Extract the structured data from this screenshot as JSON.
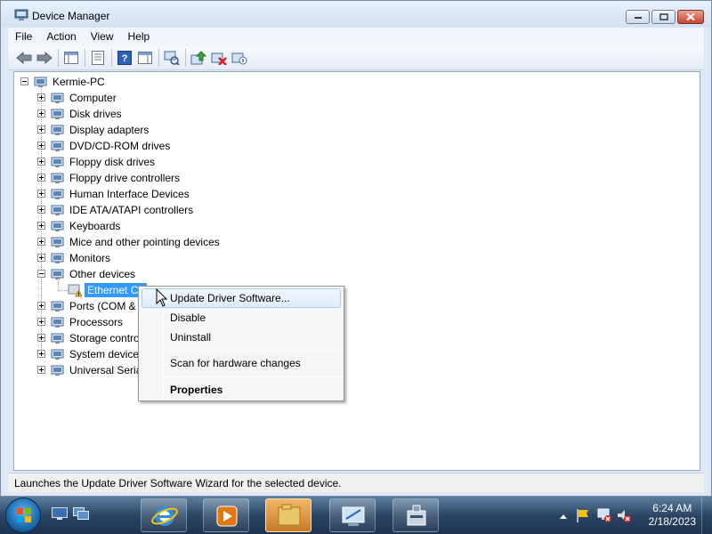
{
  "window": {
    "title": "Device Manager"
  },
  "menu": [
    "File",
    "Action",
    "View",
    "Help"
  ],
  "toolbar": {
    "icons": [
      "back-icon",
      "forward-icon",
      "show-hide-console-tree-icon",
      "properties-icon",
      "help-icon",
      "show-hide-action-pane-icon",
      "scan-hardware-icon",
      "update-driver-icon",
      "uninstall-icon",
      "disable-icon"
    ]
  },
  "tree": {
    "root": "Kermie-PC",
    "items": [
      {
        "label": "Computer",
        "icon": "computer-icon"
      },
      {
        "label": "Disk drives",
        "icon": "disk-drive-icon"
      },
      {
        "label": "Display adapters",
        "icon": "display-adapter-icon"
      },
      {
        "label": "DVD/CD-ROM drives",
        "icon": "dvd-drive-icon"
      },
      {
        "label": "Floppy disk drives",
        "icon": "floppy-drive-icon"
      },
      {
        "label": "Floppy drive controllers",
        "icon": "floppy-controller-icon"
      },
      {
        "label": "Human Interface Devices",
        "icon": "hid-icon"
      },
      {
        "label": "IDE ATA/ATAPI controllers",
        "icon": "ide-controller-icon"
      },
      {
        "label": "Keyboards",
        "icon": "keyboard-icon"
      },
      {
        "label": "Mice and other pointing devices",
        "icon": "mouse-icon"
      },
      {
        "label": "Monitors",
        "icon": "monitor-icon"
      },
      {
        "label": "Other devices",
        "icon": "other-devices-icon"
      },
      {
        "label": "Ports (COM &",
        "icon": "port-icon"
      },
      {
        "label": "Processors",
        "icon": "processor-icon"
      },
      {
        "label": "Storage contro",
        "icon": "storage-controller-icon"
      },
      {
        "label": "System devices",
        "icon": "system-devices-icon"
      },
      {
        "label": "Universal Serial",
        "icon": "usb-icon"
      }
    ],
    "child_selected": "Ethernet Co"
  },
  "context_menu": {
    "update": "Update Driver Software...",
    "disable": "Disable",
    "uninstall": "Uninstall",
    "scan": "Scan for hardware changes",
    "properties": "Properties"
  },
  "status_text": "Launches the Update Driver Software Wizard for the selected device.",
  "taskbar": {
    "time": "6:24 AM",
    "date": "2/18/2023",
    "apps": [
      "internet-explorer-icon",
      "media-player-icon",
      "file-explorer-icon",
      "control-panel-icon",
      "device-manager-icon"
    ]
  },
  "colors": {
    "selection": "#3399ff",
    "warning": "#f2c40f"
  }
}
